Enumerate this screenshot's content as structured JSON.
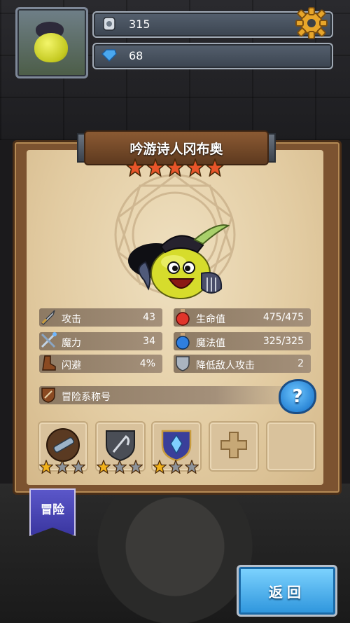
{
  "hud": {
    "trophy_value": "315",
    "gem_value": "68"
  },
  "hero": {
    "name": "吟游诗人冈布奥",
    "rarity_stars": 5
  },
  "stats": {
    "attack": {
      "label": "攻击",
      "value": "43"
    },
    "magic": {
      "label": "魔力",
      "value": "34"
    },
    "dodge": {
      "label": "闪避",
      "value": "4%"
    },
    "hp": {
      "label": "生命值",
      "value": "475/475"
    },
    "mp": {
      "label": "魔法值",
      "value": "325/325"
    },
    "reduce": {
      "label": "降低敌人攻击",
      "value": "2"
    }
  },
  "title_row": {
    "label": "冒险系称号"
  },
  "help_button": {
    "label": "?"
  },
  "equipment": [
    {
      "name": "telescope-icon",
      "stars": 1,
      "max_stars": 3
    },
    {
      "name": "scythe-shield-icon",
      "stars": 1,
      "max_stars": 3
    },
    {
      "name": "crystal-shield-icon",
      "stars": 1,
      "max_stars": 3
    }
  ],
  "adventure_tab": {
    "label": "冒险"
  },
  "back_button": {
    "label": "返回"
  },
  "colors": {
    "star_gold": "#f2b21a",
    "star_gray": "#8d939b",
    "accent_blue": "#2c94dc"
  }
}
